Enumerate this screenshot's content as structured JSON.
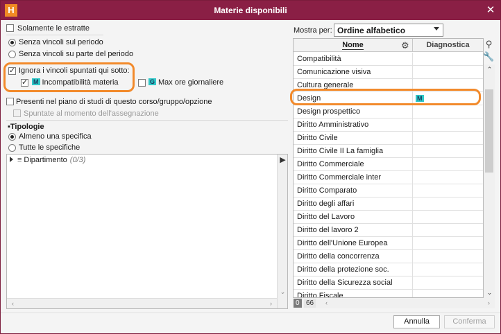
{
  "window": {
    "logo_letter": "H",
    "title": "Materie disponibili",
    "close_symbol": "✕"
  },
  "filters": {
    "solamente_estratte": "Solamente le estratte",
    "radio_periodo": [
      {
        "label": "Senza vincoli sul periodo",
        "selected": true
      },
      {
        "label": "Senza vincoli su parte del periodo",
        "selected": false
      }
    ],
    "ignora_vincoli": {
      "label": "Ignora i vincoli spuntati qui sotto:",
      "checked": true
    },
    "incompatibilita": {
      "tag": "M",
      "label": "Incompatibilità materia",
      "checked": true
    },
    "max_ore": {
      "tag": "G",
      "label": "Max ore giornaliere",
      "checked": false
    },
    "presenti_piano": {
      "label": "Presenti nel piano di studi di questo corso/gruppo/opzione",
      "checked": false
    },
    "spuntate_assegnazione": {
      "label": "Spuntate al momento dell'assegnazione",
      "checked": false,
      "disabled": true
    }
  },
  "tipologie": {
    "heading": "Tipologie",
    "options": [
      {
        "label": "Almeno una specifica",
        "selected": true
      },
      {
        "label": "Tutte le specifiche",
        "selected": false
      }
    ],
    "tree": [
      {
        "label": "Dipartimento",
        "count": "(0/3)"
      }
    ]
  },
  "right_panel": {
    "mostra_per_label": "Mostra per:",
    "sort_value": "Ordine alfabetico",
    "columns": {
      "nome": "Nome",
      "diagnostica": "Diagnostica"
    },
    "rows": [
      {
        "nome": "Compatibilità",
        "diag": ""
      },
      {
        "nome": "Comunicazione visiva",
        "diag": ""
      },
      {
        "nome": "Cultura generale",
        "diag": ""
      },
      {
        "nome": "Design",
        "diag": "M"
      },
      {
        "nome": "Design prospettico",
        "diag": ""
      },
      {
        "nome": "Diritto Amministrativo",
        "diag": ""
      },
      {
        "nome": "Diritto Civile",
        "diag": ""
      },
      {
        "nome": "Diritto Civile II La famiglia",
        "diag": ""
      },
      {
        "nome": "Diritto Commerciale",
        "diag": ""
      },
      {
        "nome": "Diritto Commerciale inter",
        "diag": ""
      },
      {
        "nome": "Diritto Comparato",
        "diag": ""
      },
      {
        "nome": "Diritto degli affari",
        "diag": ""
      },
      {
        "nome": "Diritto del Lavoro",
        "diag": ""
      },
      {
        "nome": "Diritto del lavoro 2",
        "diag": ""
      },
      {
        "nome": "Diritto dell'Unione Europea",
        "diag": ""
      },
      {
        "nome": "Diritto della concorrenza",
        "diag": ""
      },
      {
        "nome": "Diritto della protezione soc.",
        "diag": ""
      },
      {
        "nome": "Diritto della Sicurezza social",
        "diag": ""
      },
      {
        "nome": "Diritto Fiscale",
        "diag": ""
      }
    ],
    "count_selected": "0",
    "count_total": "66"
  },
  "buttons": {
    "annulla": "Annulla",
    "conferma": "Conferma"
  },
  "colors": {
    "title_bar": "#8a1f45",
    "highlight": "#f28a2b",
    "tag": "#2fc7c7"
  }
}
